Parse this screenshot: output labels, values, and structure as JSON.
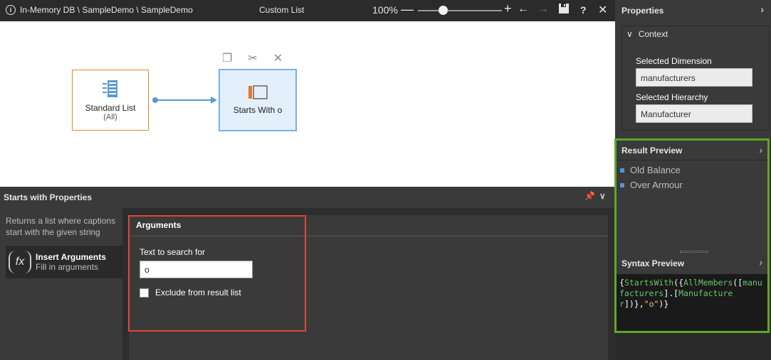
{
  "topbar": {
    "breadcrumb": "In-Memory DB \\ SampleDemo \\ SampleDemo",
    "title": "Custom List",
    "zoom": "100%",
    "zoom_minus": "—",
    "zoom_plus": "+",
    "help": "?"
  },
  "canvas": {
    "node1": {
      "label": "Standard List",
      "sub": "(All)"
    },
    "node2": {
      "label": "Starts With o"
    }
  },
  "props": {
    "title": "Starts with Properties",
    "description": "Returns a list where captions start with the given string",
    "insert": {
      "title": "Insert Arguments",
      "subtitle": "Fill in arguments"
    },
    "arguments": {
      "header": "Arguments",
      "field_label": "Text to search for",
      "field_value": "o",
      "checkbox_label": "Exclude from result list"
    }
  },
  "right": {
    "properties_title": "Properties",
    "context": {
      "title": "Context",
      "dim_label": "Selected Dimension",
      "dim_value": "manufacturers",
      "hier_label": "Selected Hierarchy",
      "hier_value": "Manufacturer"
    },
    "result_preview": {
      "title": "Result Preview",
      "items": [
        "Old Balance",
        "Over Armour"
      ]
    },
    "syntax_preview": {
      "title": "Syntax Preview",
      "code": {
        "p1": "{",
        "fn1": "StartsWith",
        "p2": "({",
        "fn2": "AllMembers",
        "p3": "([",
        "arg1": "manufacturers",
        "p4": "].[",
        "arg2": "Manufacturer",
        "p5": "])},",
        "str": "\"o\"",
        "p6": ")}"
      }
    }
  },
  "colors": {
    "accent_green": "#5ea629",
    "accent_red": "#e0463a",
    "node_blue": "#7ab0e6",
    "node_orange": "#e08a2a"
  }
}
